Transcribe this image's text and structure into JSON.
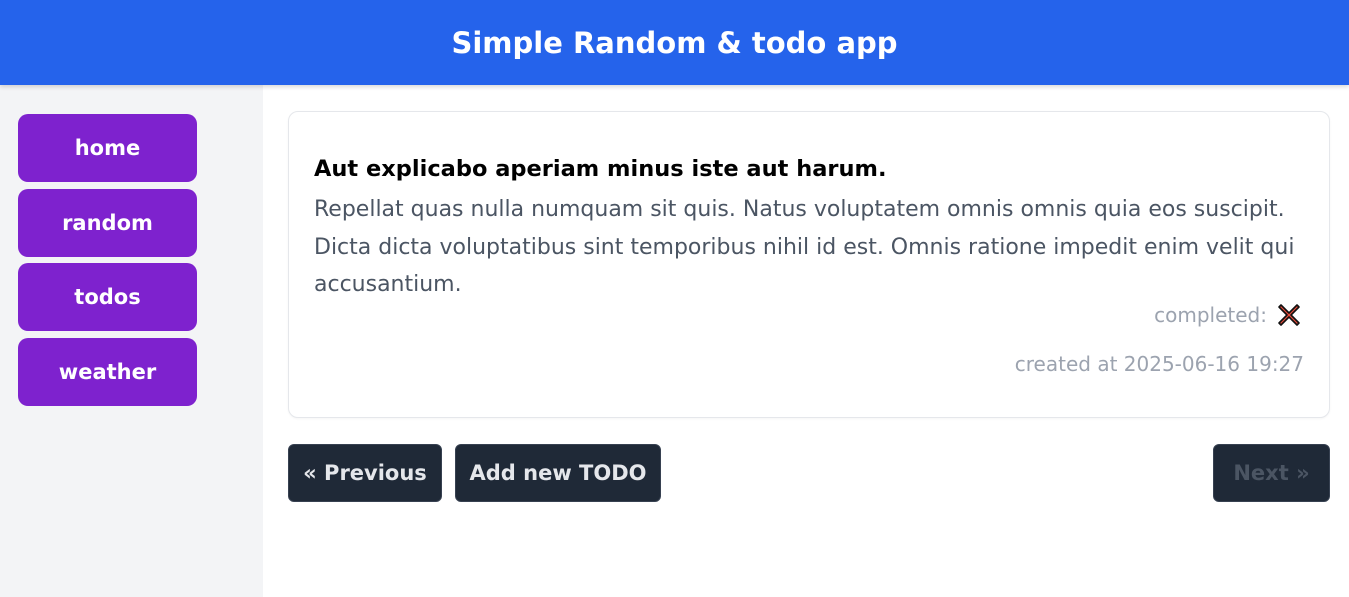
{
  "header": {
    "title": "Simple Random & todo app"
  },
  "sidebar": {
    "items": [
      {
        "label": "home"
      },
      {
        "label": "random"
      },
      {
        "label": "todos"
      },
      {
        "label": "weather"
      }
    ]
  },
  "todo": {
    "title": "Aut explicabo aperiam minus iste aut harum.",
    "body": "Repellat quas nulla numquam sit quis. Natus voluptatem omnis omnis quia eos suscipit. Dicta dicta voluptatibus sint temporibus nihil id est. Omnis ratione impedit enim velit qui accusantium.",
    "completed_label": "completed:",
    "completed_icon": "cross-mark-icon",
    "created_at": "created at 2025-06-16 19:27"
  },
  "pagination": {
    "previous_label": "« Previous",
    "add_label": "Add new TODO",
    "next_label": "Next »",
    "next_disabled": true
  },
  "colors": {
    "header_bg": "#2563eb",
    "nav_bg": "#7e22ce",
    "button_bg": "#1f2937",
    "completed_false": "#e74c3c"
  }
}
